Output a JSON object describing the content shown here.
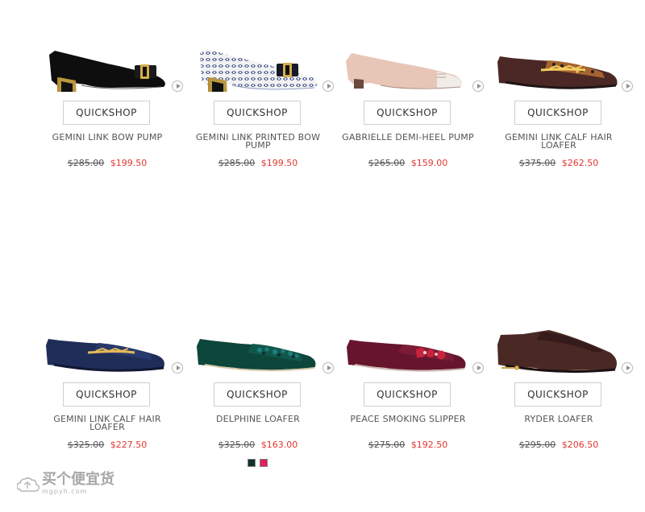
{
  "products": [
    {
      "name": "GEMINI LINK BOW PUMP",
      "old_price": "$285.00",
      "sale_price": "$199.50",
      "quickshop_label": "QUICKSHOP",
      "image": "black-leather-bow-pump",
      "colors": [
        "#111111",
        "#d9b45a"
      ]
    },
    {
      "name": "GEMINI LINK PRINTED BOW PUMP",
      "old_price": "$285.00",
      "sale_price": "$199.50",
      "quickshop_label": "QUICKSHOP",
      "image": "printed-bow-pump",
      "colors": [
        "#3a4d85",
        "#f0f0f0",
        "#d9b45a"
      ]
    },
    {
      "name": "GABRIELLE DEMI-HEEL PUMP",
      "old_price": "$265.00",
      "sale_price": "$159.00",
      "quickshop_label": "QUICKSHOP",
      "image": "blush-demi-heel-pump",
      "colors": [
        "#eac4b7",
        "#ffffff"
      ]
    },
    {
      "name": "GEMINI LINK CALF HAIR LOAFER",
      "old_price": "$375.00",
      "sale_price": "$262.50",
      "quickshop_label": "QUICKSHOP",
      "image": "brown-leopard-loafer",
      "colors": [
        "#5b2f28",
        "#b87535",
        "#e3c05b"
      ]
    },
    {
      "name": "GEMINI LINK CALF HAIR LOAFER",
      "old_price": "$325.00",
      "sale_price": "$227.50",
      "quickshop_label": "QUICKSHOP",
      "image": "navy-calf-hair-loafer",
      "colors": [
        "#253364",
        "#d7b04e"
      ]
    },
    {
      "name": "DELPHINE LOAFER",
      "old_price": "$325.00",
      "sale_price": "$163.00",
      "quickshop_label": "QUICKSHOP",
      "image": "green-jeweled-loafer",
      "colors": [
        "#0e4d3f",
        "#1e6f68"
      ],
      "swatches": [
        "#10322d",
        "#e21f5a"
      ]
    },
    {
      "name": "PEACE SMOKING SLIPPER",
      "old_price": "$275.00",
      "sale_price": "$192.50",
      "quickshop_label": "QUICKSHOP",
      "image": "burgundy-smoking-slipper",
      "colors": [
        "#6f1830",
        "#ca2137"
      ]
    },
    {
      "name": "RYDER LOAFER",
      "old_price": "$295.00",
      "sale_price": "$206.50",
      "quickshop_label": "QUICKSHOP",
      "image": "brown-ryder-loafer",
      "colors": [
        "#4d2a24",
        "#d1ac56"
      ]
    }
  ],
  "watermark": {
    "main": "买个便宜货",
    "sub": "mgpyh.com"
  }
}
